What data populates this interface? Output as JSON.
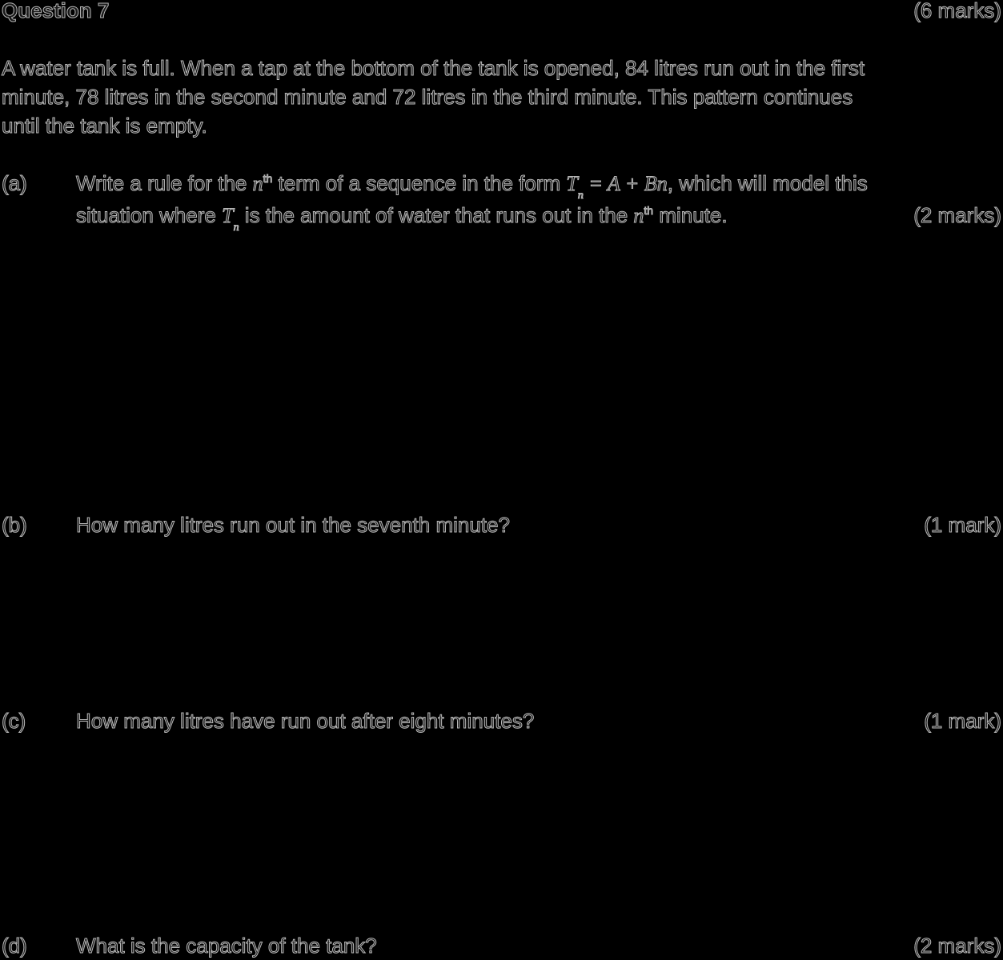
{
  "question": {
    "title": "Question 7",
    "marks": "(6 marks)"
  },
  "intro": {
    "line1": "A water tank is full. When a tap at the bottom of the tank is opened, 84 litres run out in the first",
    "line2": "minute, 78 litres in the second minute and 72 litres in the third minute. This pattern continues",
    "line3": "until the tank is empty."
  },
  "part_a": {
    "label": "(a)",
    "line1_before": "Write a rule for the ",
    "n_symbol": "n",
    "th": "th",
    "line1_mid": " term of a sequence in the form ",
    "T_symbol": "T",
    "eq_rest": " = A + Bn",
    "line1_after": ", which will model this",
    "line2_before": "situation where ",
    "line2_mid": " is the amount of water that runs out in the ",
    "line2_after": " minute.",
    "marks": "(2 marks)"
  },
  "part_b": {
    "label": "(b)",
    "text": "How many litres run out in the seventh minute?",
    "marks": "(1 mark)"
  },
  "part_c": {
    "label": "(c)",
    "text": "How many litres have run out after eight minutes?",
    "marks": "(1 mark)"
  },
  "part_d": {
    "label": "(d)",
    "text": "What is the capacity of the tank?",
    "marks": "(2 marks)"
  }
}
